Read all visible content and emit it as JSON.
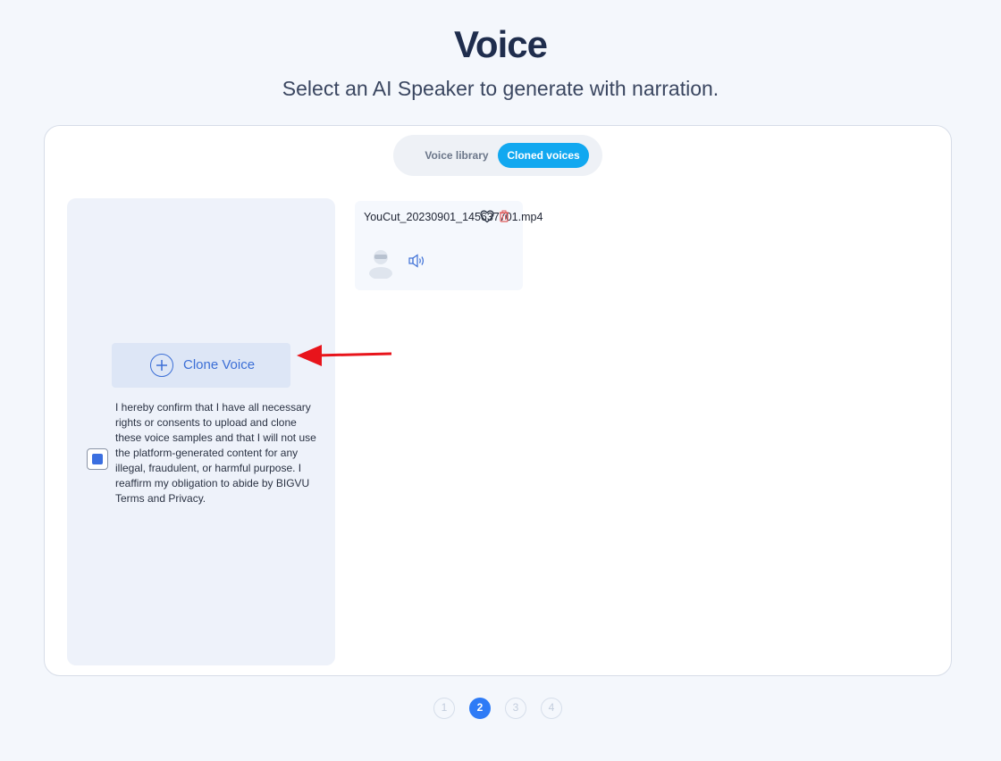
{
  "header": {
    "title": "Voice",
    "subtitle": "Select an AI Speaker to generate with narration."
  },
  "tabs": [
    {
      "label": "Voice library",
      "active": false
    },
    {
      "label": "Cloned voices",
      "active": true
    }
  ],
  "clone_panel": {
    "button_label": "Clone Voice",
    "consent_checked": true,
    "consent_text": "I hereby confirm that I have all necessary rights or consents to upload and clone these voice samples and that I will not use the platform-generated content for any illegal, fraudulent, or harmful purpose. I reaffirm my obligation to abide by BIGVU Terms and Privacy."
  },
  "voices": [
    {
      "name": "YouCut_20230901_145637701.mp4",
      "favorite": false
    }
  ],
  "pagination": {
    "pages": [
      "1",
      "2",
      "3",
      "4"
    ],
    "current": "2"
  },
  "colors": {
    "accent": "#12a8f0",
    "primary": "#3c6fd6",
    "annotation": "#e8141b"
  }
}
